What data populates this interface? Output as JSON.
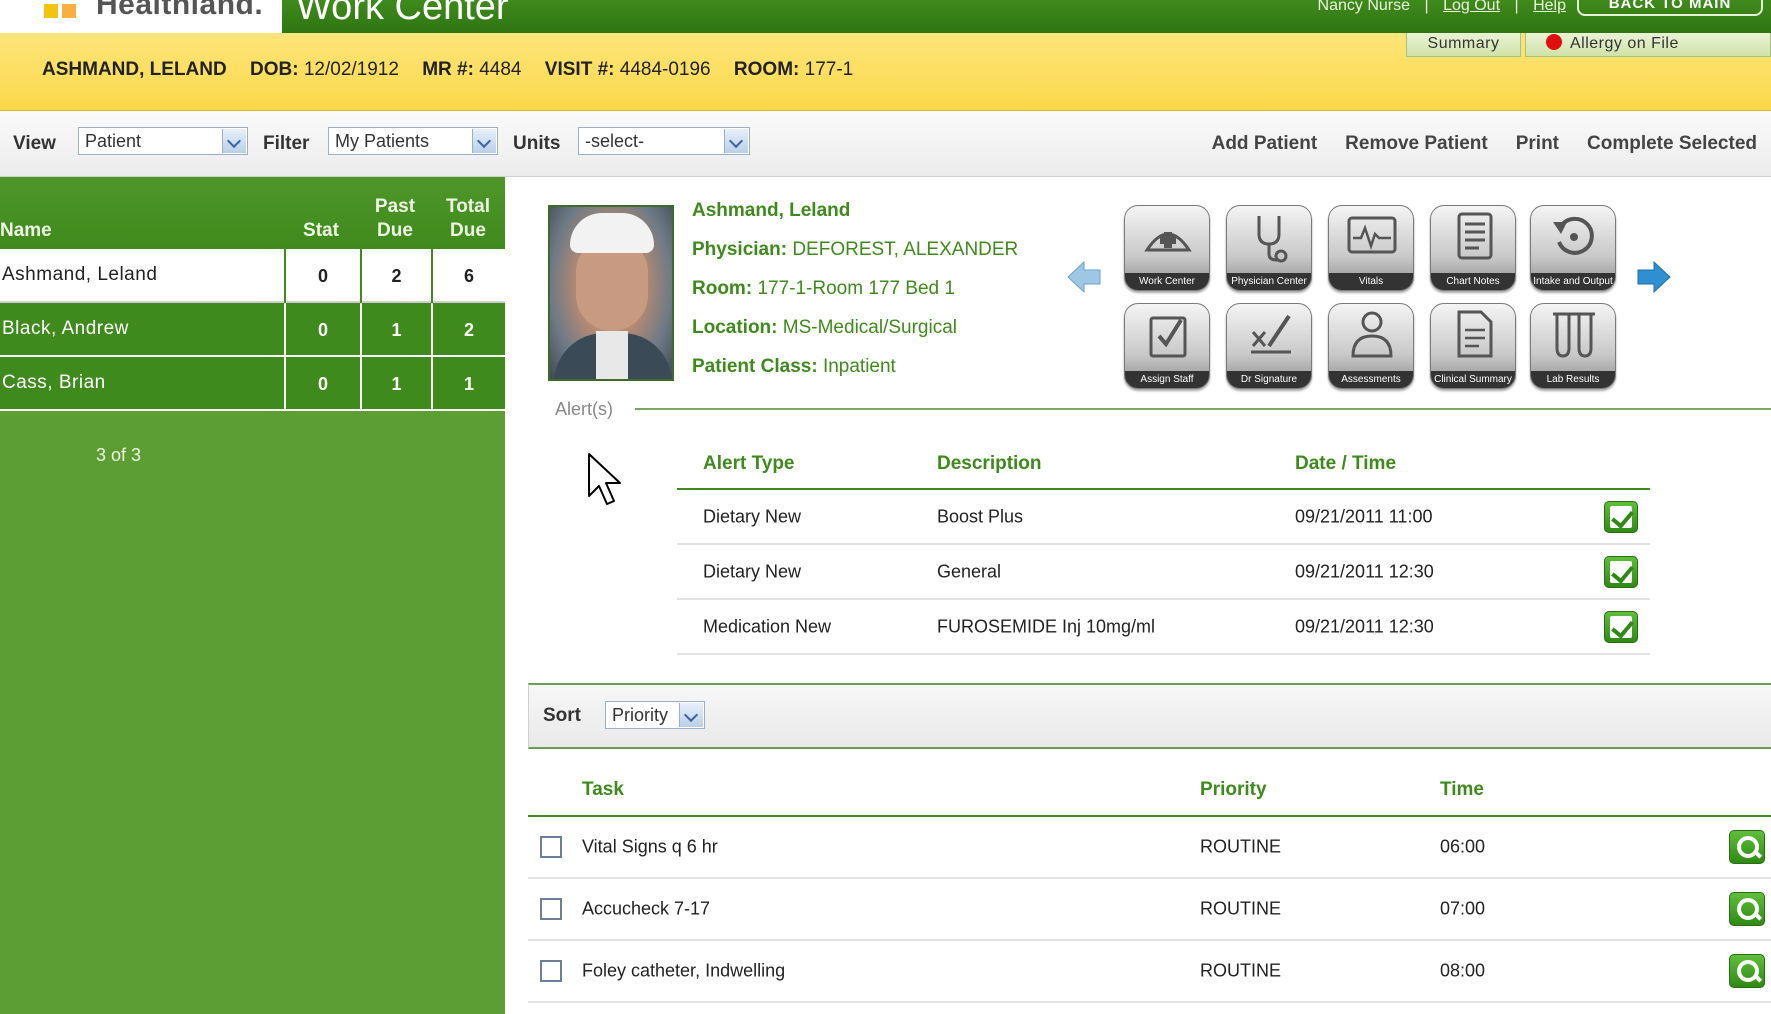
{
  "header": {
    "logo_text": "Healthland.",
    "app_title": "Work Center",
    "user_name": "Nancy Nurse",
    "logout_label": "Log Out",
    "help_label": "Help",
    "back_label": "BACK TO MAIN",
    "separator": "|"
  },
  "banner": {
    "patient_name": "ASHMAND, LELAND",
    "dob_label": "DOB:",
    "dob": "12/02/1912",
    "mr_label": "MR #:",
    "mr": "4484",
    "visit_label": "VISIT #:",
    "visit": "4484-0196",
    "room_label": "ROOM:",
    "room": "177-1",
    "summary_tab": "Summary",
    "allergy_tab": "Allergy on File",
    "allergy_color": "#e10f0f"
  },
  "toolbar": {
    "view_label": "View",
    "view_value": "Patient",
    "filter_label": "Filter",
    "filter_value": "My Patients",
    "units_label": "Units",
    "units_value": "-select-",
    "actions": [
      "Add Patient",
      "Remove Patient",
      "Print",
      "Complete Selected"
    ]
  },
  "patient_list": {
    "col_name": "Name",
    "col_stat": "Stat",
    "col_past_line1": "Past",
    "col_past_line2": "Due",
    "col_total_line1": "Total",
    "col_total_line2": "Due",
    "rows": [
      {
        "name": "Ashmand, Leland",
        "stat": "0",
        "past": "2",
        "total": "6"
      },
      {
        "name": "Black, Andrew",
        "stat": "0",
        "past": "1",
        "total": "2"
      },
      {
        "name": "Cass, Brian",
        "stat": "0",
        "past": "1",
        "total": "1"
      }
    ],
    "count": "3 of 3"
  },
  "patient_detail": {
    "name": "Ashmand, Leland",
    "physician_label": "Physician:",
    "physician": "DEFOREST, ALEXANDER",
    "room_label": "Room:",
    "room": "177-1-Room 177 Bed 1",
    "location_label": "Location:",
    "location": "MS-Medical/Surgical",
    "class_label": "Patient Class:",
    "class": "Inpatient"
  },
  "quick_icons": [
    "Work Center",
    "Physician Center",
    "Vitals",
    "Chart Notes",
    "Intake and Output",
    "Assign Staff",
    "Dr Signature",
    "Assessments",
    "Clinical Summary",
    "Lab Results"
  ],
  "alerts": {
    "caption": "Alert(s)",
    "col_type": "Alert Type",
    "col_desc": "Description",
    "col_date": "Date / Time",
    "rows": [
      {
        "type": "Dietary New",
        "desc": "Boost Plus",
        "date": "09/21/2011 11:00"
      },
      {
        "type": "Dietary New",
        "desc": "General",
        "date": "09/21/2011 12:30"
      },
      {
        "type": "Medication New",
        "desc": "FUROSEMIDE Inj 10mg/ml",
        "date": "09/21/2011 12:30"
      }
    ]
  },
  "tasks": {
    "sort_label": "Sort",
    "sort_value": "Priority",
    "col_task": "Task",
    "col_priority": "Priority",
    "col_time": "Time",
    "rows": [
      {
        "task": "Vital Signs q 6 hr",
        "priority": "ROUTINE",
        "time": "06:00"
      },
      {
        "task": "Accucheck 7-17",
        "priority": "ROUTINE",
        "time": "07:00"
      },
      {
        "task": "Foley catheter, Indwelling",
        "priority": "ROUTINE",
        "time": "08:00"
      }
    ]
  },
  "colors": {
    "brand_green": "#3f8a1c",
    "banner_yellow": "#fbd84a",
    "panel_green": "#5c9e34"
  }
}
